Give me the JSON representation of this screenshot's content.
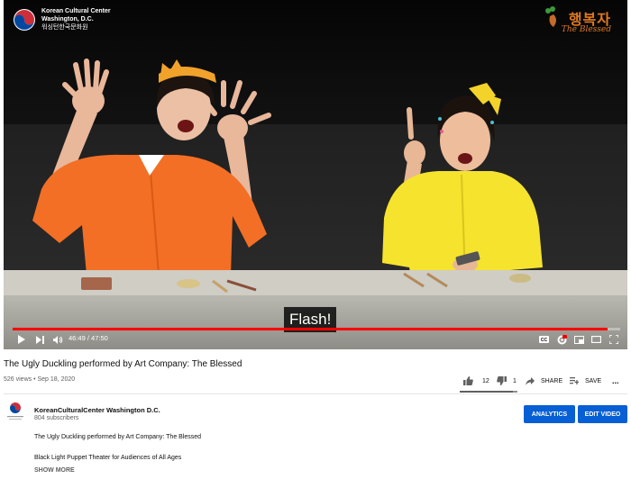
{
  "player": {
    "watermark_left": {
      "line1": "Korean Cultural Center",
      "line2": "Washington, D.C.",
      "line3": "워싱턴한국문화원"
    },
    "watermark_right": {
      "korean": "행복자",
      "english": "The Blessed"
    },
    "caption": "Flash!",
    "time_display": "46:49 / 47:50",
    "progress": 0.979,
    "accent_color": "#ff0000",
    "icons": [
      "play-icon",
      "next-icon",
      "volume-icon",
      "cc-icon",
      "settings-icon",
      "miniplayer-icon",
      "theater-icon",
      "fullscreen-icon"
    ]
  },
  "video": {
    "title": "The Ugly Duckling performed by Art Company: The Blessed",
    "views": "526 views",
    "separator": "•",
    "date": "Sep 18, 2020",
    "likes": "12",
    "dislikes": "1",
    "like_ratio": 0.92,
    "share_label": "SHARE",
    "save_label": "SAVE",
    "more_label": "..."
  },
  "channel": {
    "name": "KoreanCulturalCenter Washington D.C.",
    "subscribers": "804 subscribers",
    "analytics_label": "ANALYTICS",
    "edit_label": "EDIT VIDEO",
    "button_color": "#065fd4"
  },
  "description": {
    "line1": "The Ugly Duckling performed by Art Company: The Blessed",
    "line2": "Black Light Puppet Theater for Audiences of All Ages",
    "show_more": "SHOW MORE"
  }
}
